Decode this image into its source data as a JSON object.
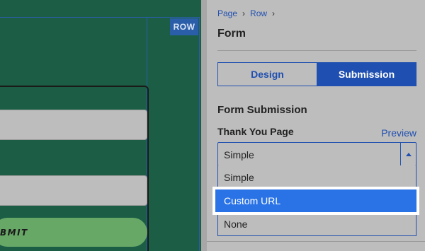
{
  "canvas": {
    "row_badge": "ROW",
    "submit_label": "BMIT",
    "colors": {
      "background": "#1b5e45",
      "guide": "#2a5ea8",
      "submit": "#68a867"
    }
  },
  "panel": {
    "breadcrumb": [
      "Page",
      "Row"
    ],
    "title": "Form",
    "tabs": [
      {
        "label": "Design",
        "active": false
      },
      {
        "label": "Submission",
        "active": true
      }
    ],
    "section_title": "Form Submission",
    "field": {
      "label": "Thank You Page",
      "preview_label": "Preview",
      "selected_value": "Simple",
      "options": [
        "Simple",
        "Custom URL",
        "None"
      ],
      "highlighted_option": "Custom URL"
    },
    "colors": {
      "accent": "#1f4fb0",
      "highlight": "#2a73e6"
    }
  },
  "icons": {
    "select_arrow": "caret-up-icon",
    "breadcrumb_separator": "chevron-right-icon"
  }
}
